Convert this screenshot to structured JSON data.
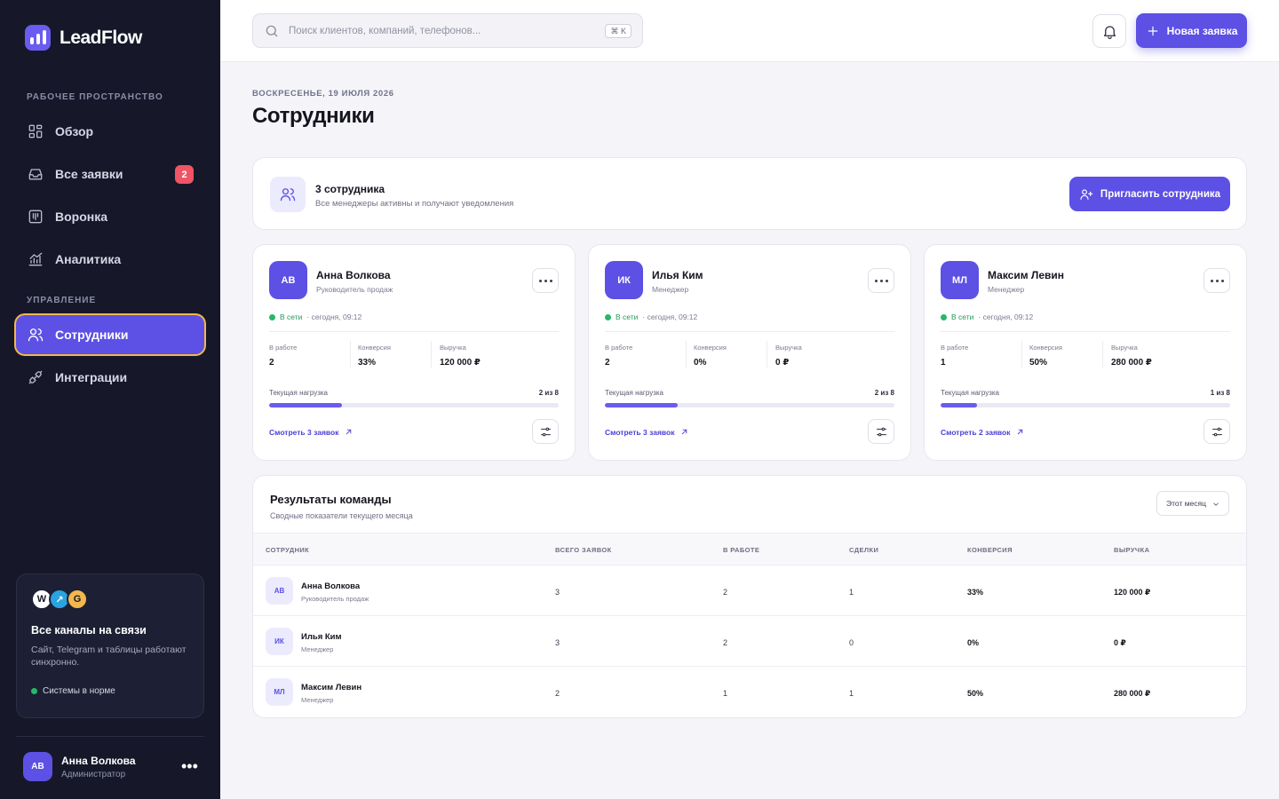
{
  "brand": {
    "name": "LeadFlow"
  },
  "sidebar": {
    "section_workspace": "РАБОЧЕЕ ПРОСТРАНСТВО",
    "section_manage": "УПРАВЛЕНИЕ",
    "items": [
      {
        "label": "Обзор",
        "icon": "grid-icon"
      },
      {
        "label": "Все заявки",
        "icon": "inbox-icon",
        "badge": "2"
      },
      {
        "label": "Воронка",
        "icon": "kanban-icon"
      },
      {
        "label": "Аналитика",
        "icon": "chart-icon"
      },
      {
        "label": "Сотрудники",
        "icon": "users-icon",
        "active": true
      },
      {
        "label": "Интеграции",
        "icon": "plug-icon"
      }
    ],
    "channels": {
      "dots": [
        "W",
        "↗",
        "G"
      ],
      "title": "Все каналы на связи",
      "description": "Сайт, Telegram и таблицы работают синхронно.",
      "status": "Системы в норме"
    },
    "user": {
      "initials": "АВ",
      "name": "Анна Волкова",
      "role": "Администратор",
      "more": "•••"
    }
  },
  "topbar": {
    "search_placeholder": "Поиск клиентов, компаний, телефонов...",
    "shortcut": "⌘ K",
    "new_button": "Новая заявка"
  },
  "page": {
    "date": "ВОСКРЕСЕНЬЕ, 19 ИЮЛЯ 2026",
    "title": "Сотрудники"
  },
  "summary": {
    "title": "3 сотрудника",
    "subtitle": "Все менеджеры активны и получают уведомления",
    "invite_button": "Пригласить сотрудника"
  },
  "labels": {
    "online": "В сети",
    "in_work": "В работе",
    "conversion": "Конверсия",
    "revenue": "Выручка",
    "load": "Текущая нагрузка"
  },
  "employees": [
    {
      "initials": "АВ",
      "name": "Анна Волкова",
      "role": "Руководитель продаж",
      "last_seen": "· сегодня, 09:12",
      "in_work": "2",
      "conversion": "33%",
      "revenue": "120 000 ₽",
      "load_text": "2 из 8",
      "load_fraction": 0.25,
      "link": "Смотреть 3 заявок"
    },
    {
      "initials": "ИК",
      "name": "Илья Ким",
      "role": "Менеджер",
      "last_seen": "· сегодня, 09:12",
      "in_work": "2",
      "conversion": "0%",
      "revenue": "0 ₽",
      "load_text": "2 из 8",
      "load_fraction": 0.25,
      "link": "Смотреть 3 заявок"
    },
    {
      "initials": "МЛ",
      "name": "Максим Левин",
      "role": "Менеджер",
      "last_seen": "· сегодня, 09:12",
      "in_work": "1",
      "conversion": "50%",
      "revenue": "280 000 ₽",
      "load_text": "1 из 8",
      "load_fraction": 0.125,
      "link": "Смотреть 2 заявок"
    }
  ],
  "results": {
    "title": "Результаты команды",
    "subtitle": "Сводные показатели текущего месяца",
    "period": "Этот месяц",
    "columns": [
      "СОТРУДНИК",
      "ВСЕГО ЗАЯВОК",
      "В РАБОТЕ",
      "СДЕЛКИ",
      "КОНВЕРСИЯ",
      "ВЫРУЧКА"
    ],
    "rows": [
      {
        "initials": "АВ",
        "name": "Анна Волкова",
        "role": "Руководитель продаж",
        "total": "3",
        "in_work": "2",
        "deals": "1",
        "conversion": "33%",
        "revenue": "120 000 ₽"
      },
      {
        "initials": "ИК",
        "name": "Илья Ким",
        "role": "Менеджер",
        "total": "3",
        "in_work": "2",
        "deals": "0",
        "conversion": "0%",
        "revenue": "0 ₽"
      },
      {
        "initials": "МЛ",
        "name": "Максим Левин",
        "role": "Менеджер",
        "total": "2",
        "in_work": "1",
        "deals": "1",
        "conversion": "50%",
        "revenue": "280 000 ₽"
      }
    ]
  },
  "colors": {
    "accent": "#5d50e4",
    "sidebar": "#161829",
    "badge": "#ef5565",
    "online": "#26b868",
    "focus_ring": "#f2b84b"
  }
}
